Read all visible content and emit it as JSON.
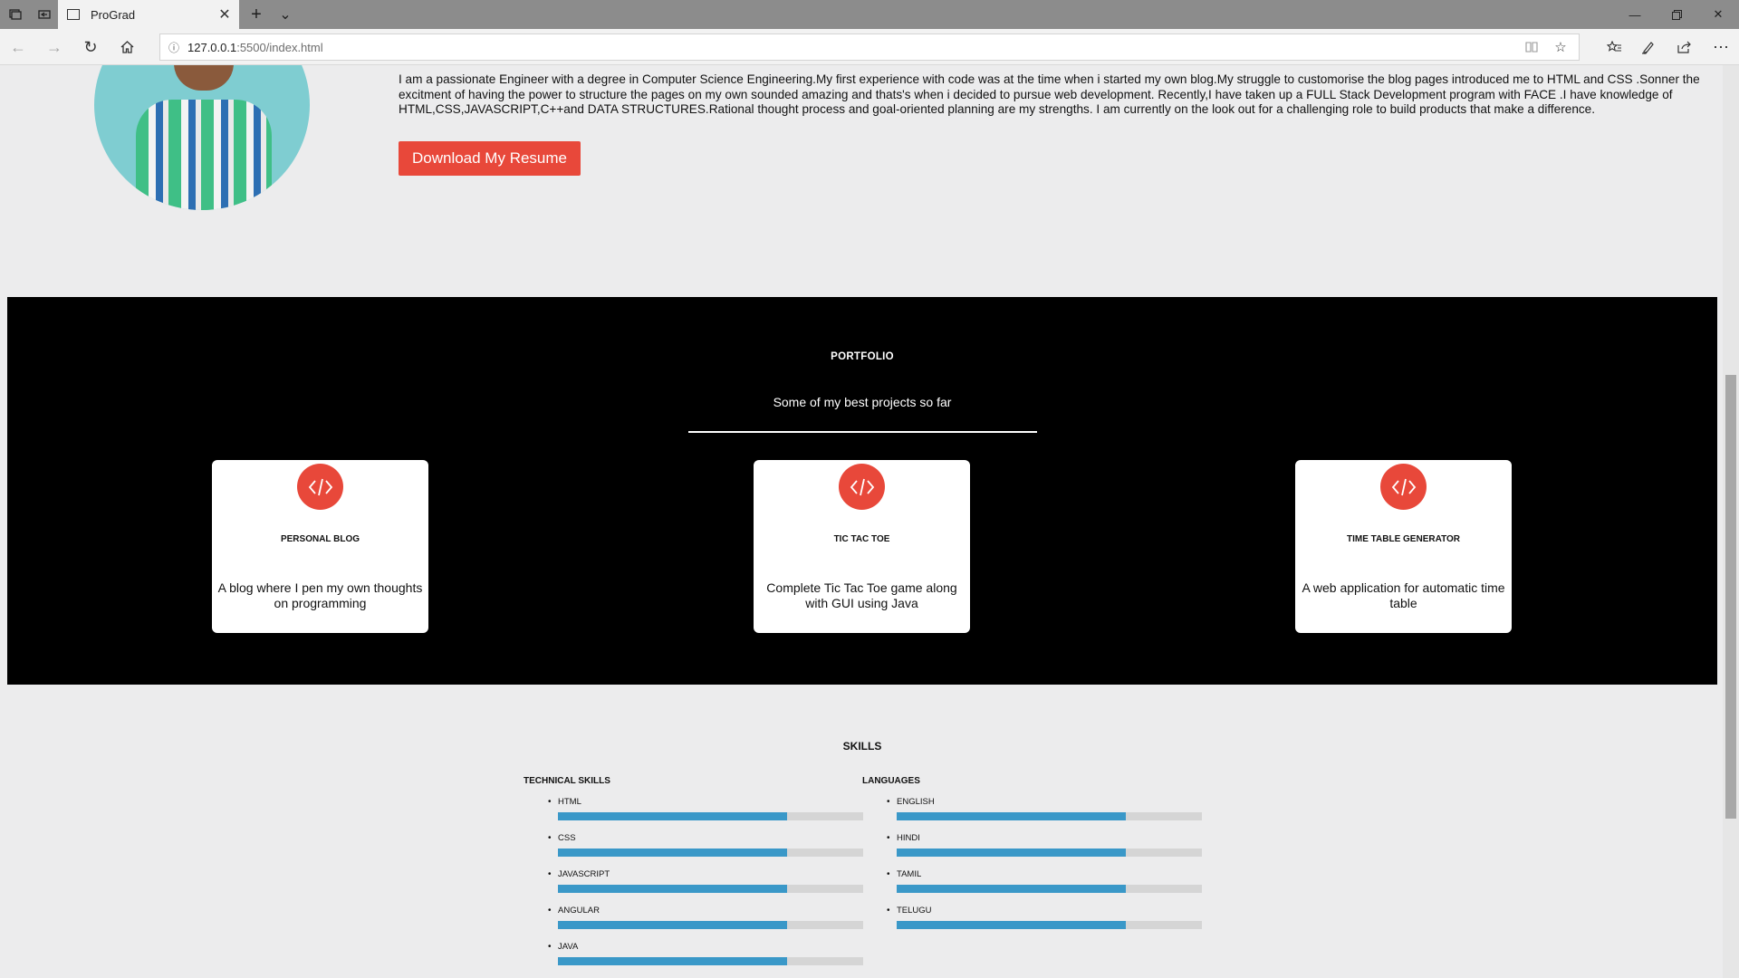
{
  "browser": {
    "tab_title": "ProGrad",
    "url_host": "127.0.0.1",
    "url_path": ":5500/index.html",
    "new_tab_label": "+",
    "tab_list_label": "⌄"
  },
  "about": {
    "text": "I am a passionate Engineer with a degree in Computer Science Engineering.My first experience with code was at the time when i started my own blog.My struggle to customorise the blog pages introduced me to HTML and CSS .Sonner the excitment of having the power to structure the pages on my own sounded amazing and thats's when i decided to pursue web development. Recently,I have taken up a FULL Stack Development program with FACE .I have knowledge of HTML,CSS,JAVASCRIPT,C++and DATA STRUCTURES.Rational thought process and goal-oriented planning are my strengths. I am currently on the look out for a challenging role to build products that make a difference.",
    "resume_button": "Download My Resume"
  },
  "portfolio": {
    "title": "PORTFOLIO",
    "subtitle": "Some of my best projects so far",
    "projects": [
      {
        "title": "PERSONAL BLOG",
        "description": "A blog where I pen my own thoughts on programming",
        "icon": "code-icon"
      },
      {
        "title": "TIC TAC TOE",
        "description": "Complete Tic Tac Toe game along with GUI using Java",
        "icon": "code-icon"
      },
      {
        "title": "TIME TABLE GENERATOR",
        "description": "A web application for automatic time table",
        "icon": "code-icon"
      }
    ]
  },
  "skills": {
    "title": "SKILLS",
    "technical": {
      "heading": "TECHNICAL SKILLS",
      "items": [
        {
          "name": "HTML",
          "level": 0.75
        },
        {
          "name": "CSS",
          "level": 0.75
        },
        {
          "name": "JAVASCRIPT",
          "level": 0.75
        },
        {
          "name": "ANGULAR",
          "level": 0.75
        },
        {
          "name": "JAVA",
          "level": 0.75
        }
      ]
    },
    "languages": {
      "heading": "LANGUAGES",
      "items": [
        {
          "name": "ENGLISH",
          "level": 0.75
        },
        {
          "name": "HINDI",
          "level": 0.75
        },
        {
          "name": "TAMIL",
          "level": 0.75
        },
        {
          "name": "TELUGU",
          "level": 0.75
        }
      ]
    }
  },
  "colors": {
    "accent": "#e8483a",
    "bar_fill": "#3a98c8",
    "bar_track": "#d5d5d5",
    "portfolio_bg": "#000000"
  }
}
